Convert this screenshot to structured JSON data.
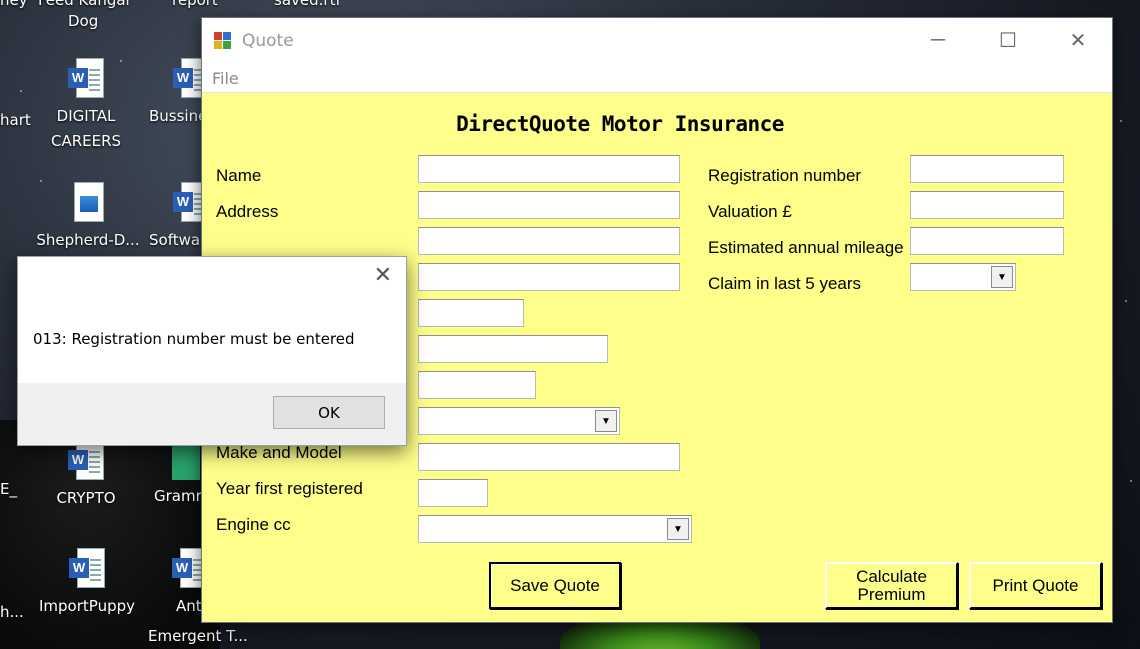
{
  "desktop": {
    "top_labels": [
      "ney",
      "Feed Kangal",
      "report",
      "saved.rtf"
    ],
    "icons": [
      {
        "label": "Dog",
        "type": "partial"
      },
      {
        "label": "DIGITAL CAREERS",
        "type": "word"
      },
      {
        "label": "Bussine",
        "type": "word"
      },
      {
        "label": "hart",
        "type": "partial"
      },
      {
        "label": "Shepherd-D...",
        "type": "image"
      },
      {
        "label": "Softwa",
        "type": "word"
      },
      {
        "label": "CRYPTO",
        "type": "word"
      },
      {
        "label": "Gramr",
        "type": "shortcut"
      },
      {
        "label": "E_",
        "type": "partial"
      },
      {
        "label": "ImportPuppy",
        "type": "word"
      },
      {
        "label": "Ant",
        "type": "word"
      },
      {
        "label": "Emergent T...",
        "type": "text"
      },
      {
        "label": "h...",
        "type": "partial"
      }
    ]
  },
  "window": {
    "title": "Quote",
    "menu": {
      "file": "File"
    },
    "controls": {
      "minimize": "─",
      "maximize": "☐",
      "close": "✕"
    }
  },
  "form": {
    "title": "DirectQuote Motor Insurance",
    "labels": {
      "name": "Name",
      "address": "Address",
      "make_model": "Make and Model",
      "year_registered": "Year first registered",
      "engine_cc": "Engine cc",
      "registration_number": "Registration number",
      "valuation": "Valuation £",
      "mileage": "Estimated annual mileage",
      "claim": "Claim in last 5 years"
    },
    "values": {
      "name": "",
      "address1": "",
      "address2": "",
      "address3": "",
      "field5": "",
      "field6": "",
      "field7": "",
      "combo8": "",
      "make_model": "",
      "year_registered": "",
      "engine_cc": "",
      "registration_number": "",
      "valuation": "",
      "mileage": "",
      "claim": ""
    },
    "buttons": {
      "save": "Save Quote",
      "calculate": "Calculate Premium",
      "print": "Print Quote"
    }
  },
  "dialog": {
    "message": "013: Registration number must be entered",
    "ok": "OK",
    "close": "✕"
  }
}
